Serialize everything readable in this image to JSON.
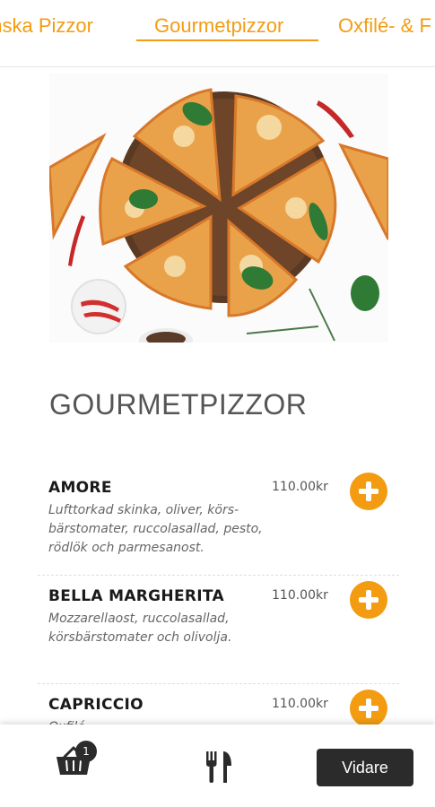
{
  "tabs": [
    {
      "label": "Italienska Pizzor",
      "visible_label": "anska Pizzor"
    },
    {
      "label": "Gourmetpizzor",
      "active": true
    },
    {
      "label": "Oxfilé- & Fläskfilépizzor",
      "visible_label": "Oxfilé- & F"
    }
  ],
  "colors": {
    "accent": "#f39c12",
    "dark": "#2b2b2b"
  },
  "section": {
    "title": "GOURMETPIZZOR"
  },
  "items": [
    {
      "name": "AMORE",
      "price": "110.00kr",
      "description": "Lufttorkad skinka, oliver, körs-bärstomater, ruccolasallad, pesto, rödlök och parmesanost."
    },
    {
      "name": "BELLA MARGHERITA",
      "price": "110.00kr",
      "description": "Mozzarellaost, ruccolasallad, körsbärstomater och olivolja."
    },
    {
      "name": "CAPRICCIO",
      "price": "110.00kr",
      "description": "Oxfilé, ..."
    }
  ],
  "bottom": {
    "cart_count": "1",
    "next_label": "Vidare",
    "cart_icon": "basket-icon",
    "menu_icon": "cutlery-icon"
  }
}
